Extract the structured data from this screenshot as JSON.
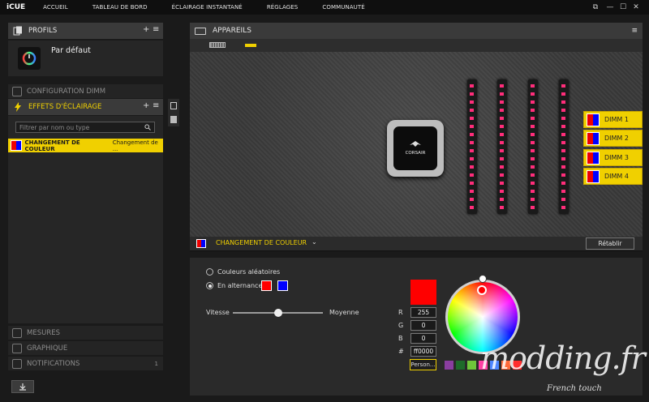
{
  "topbar": {
    "logo": "iCUE",
    "nav": [
      "ACCUEIL",
      "TABLEAU DE BORD",
      "ÉCLAIRAGE INSTANTANÉ",
      "RÉGLAGES",
      "COMMUNAUTÉ"
    ],
    "window_controls": [
      "⧉",
      "—",
      "☐",
      "✕"
    ]
  },
  "profiles": {
    "title": "PROFILS",
    "add": "+",
    "menu": "≡",
    "current": "Par défaut"
  },
  "dimm_config": {
    "title": "CONFIGURATION DIMM"
  },
  "effects": {
    "title": "EFFETS D'ÉCLAIRAGE",
    "add": "+",
    "menu": "≡",
    "filter_placeholder": "Filtrer par nom ou type",
    "items": [
      {
        "type": "CHANGEMENT DE COULEUR",
        "name": "Changement de ..."
      }
    ]
  },
  "bottom_sections": {
    "measures": "MESURES",
    "graph": "GRAPHIQUE",
    "notifications": "NOTIFICATIONS",
    "notif_count": "1"
  },
  "devices": {
    "title": "APPAREILS"
  },
  "dimms": [
    "DIMM 1",
    "DIMM 2",
    "DIMM 3",
    "DIMM 4"
  ],
  "effect_bar": {
    "effect_name": "CHANGEMENT DE COULEUR",
    "reset_label": "Rétablir"
  },
  "effect_settings": {
    "random_colors": "Couleurs aléatoires",
    "alternating": "En alternance",
    "speed_label": "Vitesse",
    "speed_value": "Moyenne",
    "speed_fraction": 0.5,
    "r_label": "R",
    "g_label": "G",
    "b_label": "B",
    "hex_label": "#",
    "r": "255",
    "g": "0",
    "b": "0",
    "hex": "ff0000",
    "custom_label": "Person..."
  },
  "colors": {
    "accent": "#f0d000",
    "selected_color": "#ff0000",
    "alt_color_1": "#ff0000",
    "alt_color_2": "#0000ff",
    "led": "#ff2d7a",
    "palette": [
      "#8a3ea0",
      "#1e6b2a",
      "#6fc63a",
      "#ff3fa4",
      "#4d86ff",
      "#ff6a3a",
      "#ff2d2d"
    ]
  },
  "watermark": {
    "brand": "modding.fr",
    "tagline": "French touch"
  }
}
